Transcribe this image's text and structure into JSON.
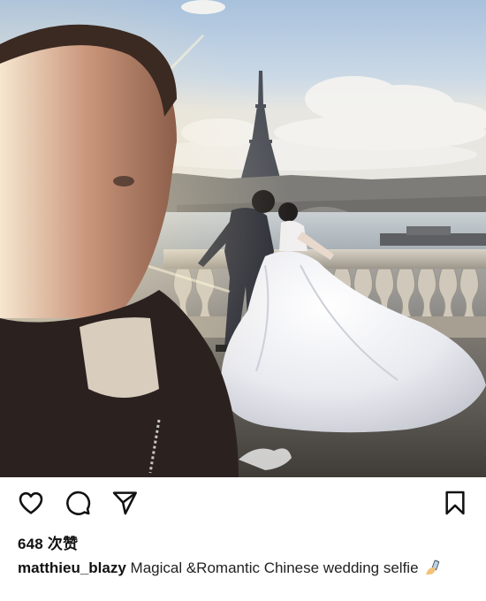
{
  "post": {
    "photo_alt": "Selfie with a couple in wedding attire kissing on a bridge, Eiffel Tower in the background",
    "likes_text": "648 次赞",
    "caption": {
      "username": "matthieu_blazy",
      "text": " Magical &Romantic Chinese wedding selfie ",
      "emoji_icon": "selfie-emoji-icon"
    },
    "actions": {
      "like_icon": "heart-icon",
      "comment_icon": "comment-bubble-icon",
      "share_icon": "paper-plane-icon",
      "save_icon": "bookmark-icon"
    }
  }
}
